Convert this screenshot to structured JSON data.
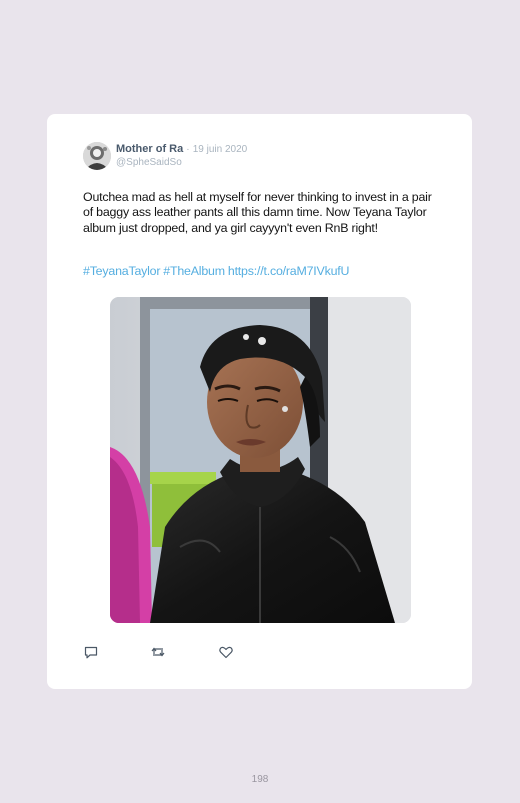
{
  "tweet": {
    "display_name": "Mother of Ra",
    "separator": "·",
    "date": "19 juin 2020",
    "handle": "@SpheSaidSo",
    "text": "Outchea mad as hell at myself for never thinking to invest in a pair of baggy ass leather pants all this damn time. Now Teyana Taylor album just dropped, and ya girl cayyyn't even RnB right!",
    "hashtag_1": "#TeyanaTaylor",
    "hashtag_2": "#TheAlbum",
    "link": "https://t.co/raM7IVkufU",
    "actions": [
      "reply-icon",
      "retweet-icon",
      "like-icon"
    ]
  },
  "page": {
    "number": "198"
  },
  "colors": {
    "background": "#e9e4ec",
    "card": "#ffffff",
    "link": "#55aee0",
    "name": "#4a5a6c",
    "muted": "#a9b4bf"
  }
}
